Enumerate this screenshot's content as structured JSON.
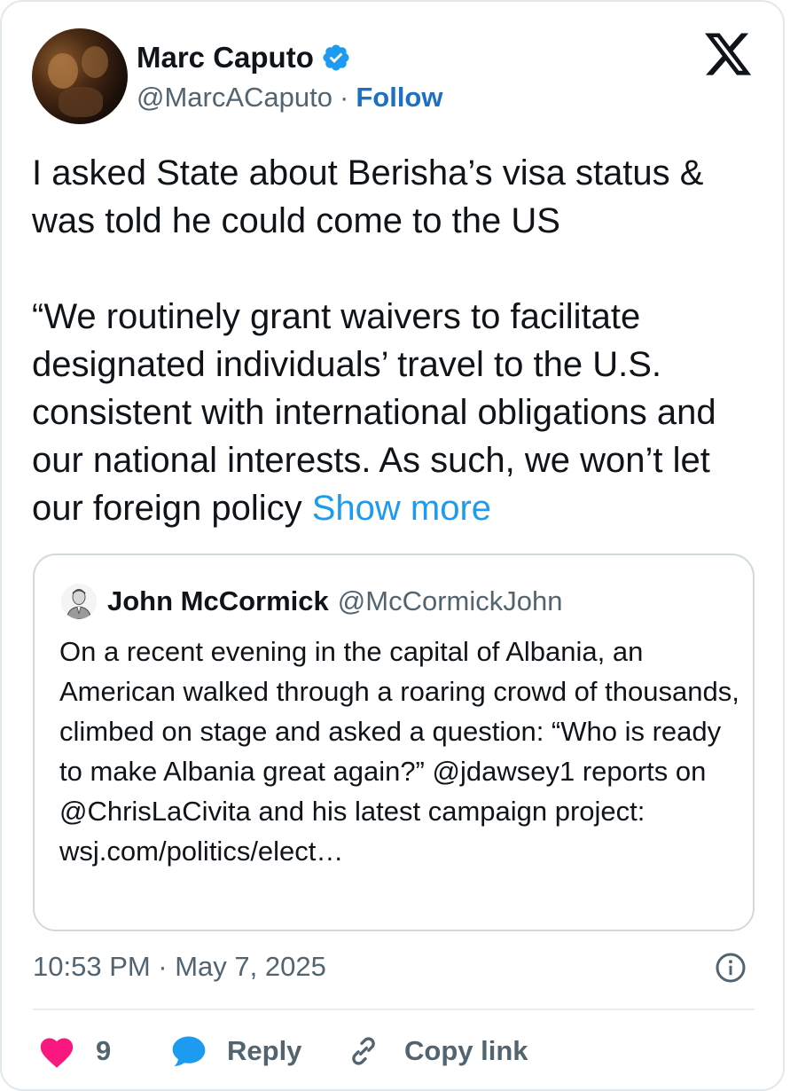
{
  "author": {
    "name": "Marc Caputo",
    "handle": "@MarcACaputo",
    "separator": "·",
    "follow_label": "Follow"
  },
  "tweet": {
    "paragraph1": "I asked State about Berisha’s visa status & was told he could come to the US",
    "paragraph2": "“We routinely grant waivers to facilitate designated individuals’ travel to the U.S. consistent with international obligations and our national interests. As such, we won’t let our foreign policy ",
    "show_more_label": "Show more"
  },
  "quoted_tweet": {
    "name": "John McCormick",
    "handle": "@McCormickJohn",
    "text": "On a recent evening in the capital of Albania, an American walked through a roaring crowd of thousands, climbed on stage and asked a question: “Who is ready to make Albania great again?” @jdawsey1 reports on @ChrisLaCivita and his latest campaign project: wsj.com/politics/elect…"
  },
  "meta": {
    "timestamp": "10:53 PM · May 7, 2025"
  },
  "actions": {
    "like_count": "9",
    "reply_label": "Reply",
    "copy_link_label": "Copy link"
  },
  "icons": {
    "verified": "verified-badge-icon",
    "logo": "x-logo-icon",
    "info": "info-icon",
    "like": "heart-icon",
    "reply": "chat-bubble-icon",
    "copy_link": "link-icon"
  },
  "colors": {
    "accent": "#1d9bf0",
    "follow": "#1d6fc4",
    "heart": "#f91880",
    "secondary_text": "#536471",
    "border": "#cfd9de"
  }
}
